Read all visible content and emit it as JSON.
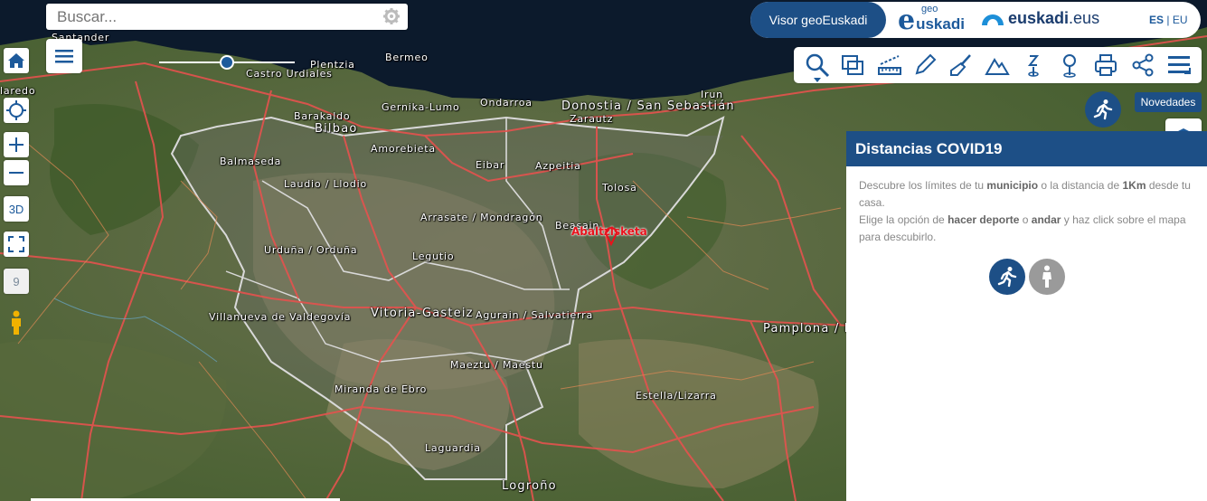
{
  "search": {
    "placeholder": "Buscar..."
  },
  "left_tools": {
    "three_d_label": "3D",
    "zoom_level": "9"
  },
  "header": {
    "visor_label": "Visor geoEuskadi",
    "logo_geo_small": "geo",
    "logo_geo_letter": "e",
    "logo_geo_text": "uskadi",
    "logo_eus_name": "euskadi",
    "logo_eus_domain": ".eus",
    "lang_es": "ES",
    "lang_sep": "|",
    "lang_eu": "EU"
  },
  "novedades_label": "Novedades",
  "panel": {
    "title": "Distancias COVID19",
    "p1_a": "Descubre los límites de tu ",
    "p1_b": "municipio",
    "p1_c": " o la distancia de ",
    "p1_d": "1Km",
    "p1_e": " desde tu casa.",
    "p2_a": "Elige la opción de ",
    "p2_b": "hacer deporte",
    "p2_c": " o ",
    "p2_d": "andar",
    "p2_e": " y haz click sobre el mapa para descubirlo."
  },
  "map_labels": {
    "santander": "Santander",
    "plentzia": "Plentzia",
    "bermeo": "Bermeo",
    "castro": "Castro Urdiales",
    "laredo": "laredo",
    "gernika": "Gernika-Lumo",
    "ondarroa": "Ondarroa",
    "donostia": "Donostia / San Sebastián",
    "irun": "Irun",
    "barakaldo": "Barakaldo",
    "bilbao": "Bilbao",
    "zarautz": "Zarautz",
    "amorebieta": "Amorebieta",
    "balmaseda": "Balmaseda",
    "eibar": "Eibar",
    "azpeitia": "Azpeitia",
    "laudio": "Laudio / Llodio",
    "tolosa": "Tolosa",
    "arrasate": "Arrasate / Mondragón",
    "beasain": "Beasain",
    "abaltzisketa": "Abaltzisketa",
    "urduna": "Urduña / Orduña",
    "legutio": "Legutio",
    "villanueva": "Villanueva de Valdegovía",
    "vitoria": "Vitoria-Gasteiz",
    "agurain": "Agurain / Salvatierra",
    "pamplona": "Pamplona / Iruña",
    "maeztu": "Maeztu / Maestu",
    "miranda": "Miranda de Ebro",
    "estella": "Estella/Lizarra",
    "laguardia": "Laguardia",
    "logrono": "Logroño"
  },
  "opacity_slider": {
    "value": 0.5
  },
  "colors": {
    "brand": "#1d4f86",
    "roads": "#e5524e",
    "borders": "#d9d9d9"
  }
}
